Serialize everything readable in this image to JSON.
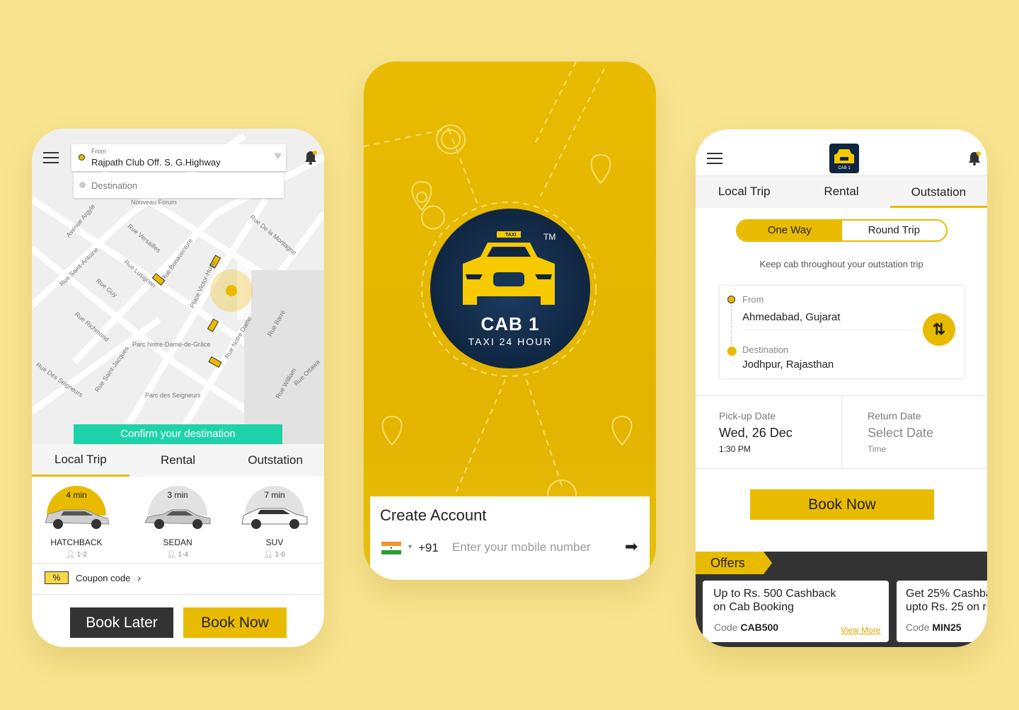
{
  "colors": {
    "background": "#f8e38f",
    "accent": "#e8bb00",
    "teal": "#1fd3a8",
    "dark": "#333333",
    "navy": "#0f2540"
  },
  "screen1": {
    "from_label": "From",
    "from_value": "Rajpath Club Off. S. G.Highway",
    "destination_placeholder": "Destination",
    "map_labels": [
      "Rue Versailles",
      "Rue Saint-Antoine",
      "Rue Guy",
      "Rue Richmond",
      "Parc Notre-Dame-de-Grâce",
      "Rue Saint-Jacques",
      "Parc des Seigneurs",
      "Rue Des Seigneurs",
      "Rue De la Montagne",
      "Rue Notre Dame",
      "Place Victor-Hugo",
      "Rue Barré",
      "Rue William",
      "Rue Ottawa",
      "Nouveau Forum",
      "Avenue Argyle",
      "Rue Lusignan",
      "Rue Bonaventure"
    ],
    "confirm_label": "Confirm your destination",
    "tabs": [
      "Local Trip",
      "Rental",
      "Outstation"
    ],
    "active_tab": 0,
    "cabs": [
      {
        "eta": "4 min",
        "type": "HATCHBACK",
        "seats": "1-2",
        "selected": true
      },
      {
        "eta": "3 min",
        "type": "SEDAN",
        "seats": "1-4",
        "selected": false
      },
      {
        "eta": "7 min",
        "type": "SUV",
        "seats": "1-6",
        "selected": false
      }
    ],
    "coupon_label": "Coupon code",
    "book_later": "Book Later",
    "book_now": "Book Now"
  },
  "screen2": {
    "logo": {
      "brand": "CAB 1",
      "tagline": "TAXI 24 HOUR",
      "tm": "TM",
      "roof_sign": "TAXI"
    },
    "title": "Create Account",
    "country_code": "+91",
    "phone_placeholder": "Enter your mobile number"
  },
  "screen3": {
    "tabs": [
      "Local Trip",
      "Rental",
      "Outstation"
    ],
    "active_tab": 2,
    "trip_types": [
      "One Way",
      "Round Trip"
    ],
    "active_trip_type": 0,
    "hint": "Keep cab throughout your outstation trip",
    "from_label": "From",
    "from_value": "Ahmedabad, Gujarat",
    "destination_label": "Destination",
    "destination_value": "Jodhpur, Rajasthan",
    "pickup": {
      "label": "Pick-up Date",
      "date": "Wed, 26 Dec",
      "time": "1:30 PM"
    },
    "return": {
      "label": "Return Date",
      "date": "Select Date",
      "time": "Time"
    },
    "book_now": "Book Now",
    "offers_title": "Offers",
    "offers": [
      {
        "line1": "Up to Rs. 500 Cashback",
        "line2": "on Cab Booking",
        "code_label": "Code",
        "code": "CAB500",
        "link": "View More"
      },
      {
        "line1": "Get 25% Cashba",
        "line2": "upto Rs. 25 on r",
        "code_label": "Code",
        "code": "MIN25"
      }
    ]
  }
}
